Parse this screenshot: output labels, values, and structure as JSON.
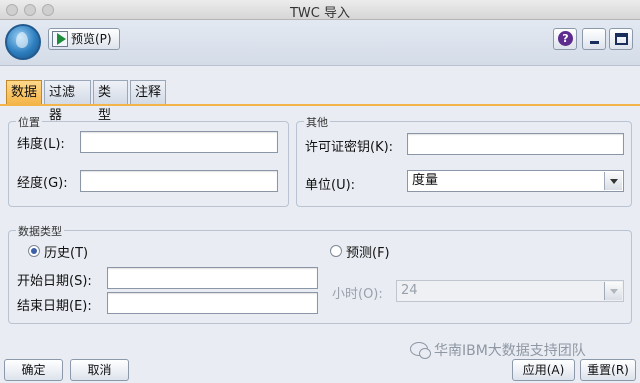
{
  "window": {
    "title": "TWC 导入"
  },
  "toolbar": {
    "preview_label": "预览(P)",
    "help_label": "?"
  },
  "tabs": [
    {
      "label": "数据",
      "active": true
    },
    {
      "label": "过滤器",
      "active": false
    },
    {
      "label": "类型",
      "active": false
    },
    {
      "label": "注释",
      "active": false
    }
  ],
  "location": {
    "title": "位置",
    "latitude_label": "纬度(L):",
    "latitude_value": "",
    "longitude_label": "经度(G):",
    "longitude_value": ""
  },
  "other": {
    "title": "其他",
    "license_label": "许可证密钥(K):",
    "license_value": "",
    "unit_label": "单位(U):",
    "unit_value": "度量"
  },
  "data_type": {
    "title": "数据类型",
    "history_label": "历史(T)",
    "history_selected": true,
    "forecast_label": "预测(F)",
    "forecast_selected": false,
    "start_date_label": "开始日期(S):",
    "start_date_value": "",
    "end_date_label": "结束日期(E):",
    "end_date_value": "",
    "hours_label": "小时(O):",
    "hours_value": "24"
  },
  "footer": {
    "ok_label": "确定",
    "cancel_label": "取消",
    "apply_label": "应用(A)",
    "reset_label": "重置(R)"
  },
  "watermark": "华南IBM大数据支持团队"
}
